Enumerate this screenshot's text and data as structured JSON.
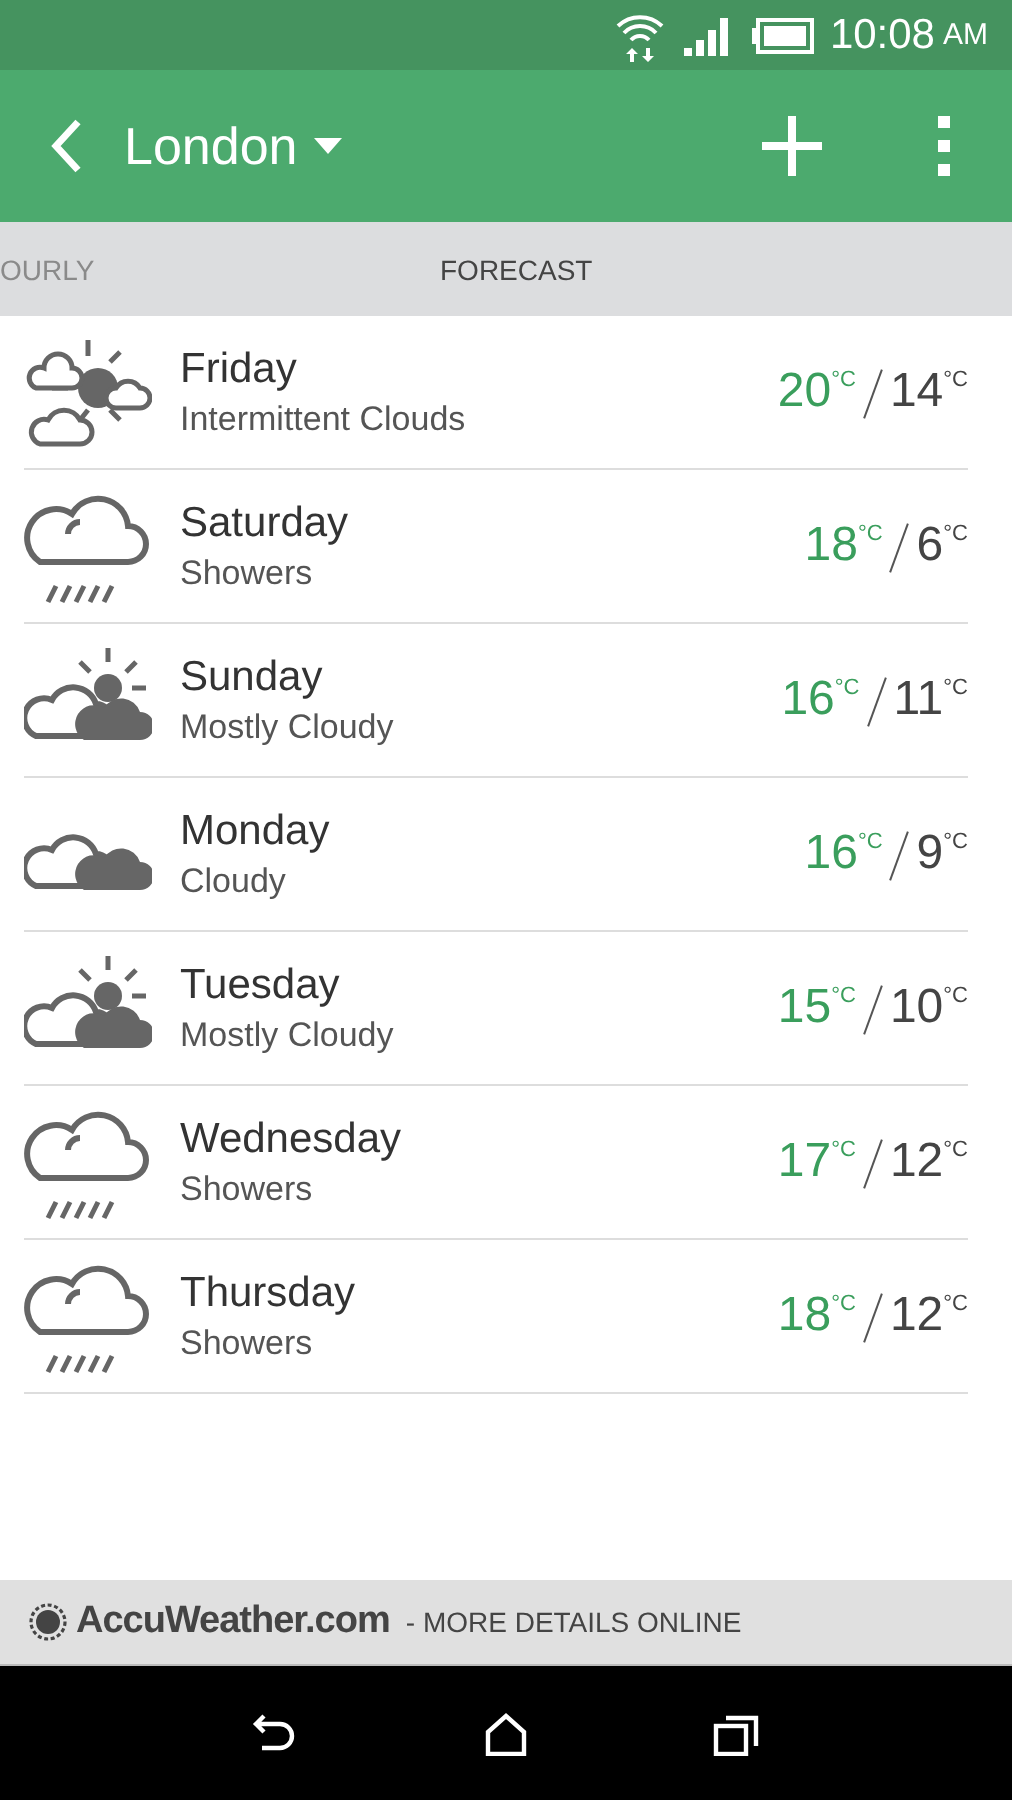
{
  "status_bar": {
    "time": "10:08",
    "meridiem": "AM"
  },
  "app_bar": {
    "title": "London"
  },
  "tabs": [
    {
      "label": "OURLY",
      "selected": false
    },
    {
      "label": "FORECAST",
      "selected": true
    }
  ],
  "days": [
    {
      "kind": "partly-sunny",
      "day": "Friday",
      "condition": "Intermittent Clouds",
      "high": "20",
      "high_unit": "°C",
      "low": "14",
      "low_unit": "°C"
    },
    {
      "kind": "showers",
      "day": "Saturday",
      "condition": "Showers",
      "high": "18",
      "high_unit": "°C",
      "low": "6",
      "low_unit": "°C"
    },
    {
      "kind": "mostly-cloudy",
      "day": "Sunday",
      "condition": "Mostly Cloudy",
      "high": "16",
      "high_unit": "°C",
      "low": "11",
      "low_unit": "°C"
    },
    {
      "kind": "cloudy",
      "day": "Monday",
      "condition": "Cloudy",
      "high": "16",
      "high_unit": "°C",
      "low": "9",
      "low_unit": "°C"
    },
    {
      "kind": "mostly-cloudy",
      "day": "Tuesday",
      "condition": "Mostly Cloudy",
      "high": "15",
      "high_unit": "°C",
      "low": "10",
      "low_unit": "°C"
    },
    {
      "kind": "showers",
      "day": "Wednesday",
      "condition": "Showers",
      "high": "17",
      "high_unit": "°C",
      "low": "12",
      "low_unit": "°C"
    },
    {
      "kind": "showers",
      "day": "Thursday",
      "condition": "Showers",
      "high": "18",
      "high_unit": "°C",
      "low": "12",
      "low_unit": "°C"
    }
  ],
  "footer": {
    "brand": "AccuWeather.com",
    "link": "- MORE DETAILS ONLINE"
  }
}
